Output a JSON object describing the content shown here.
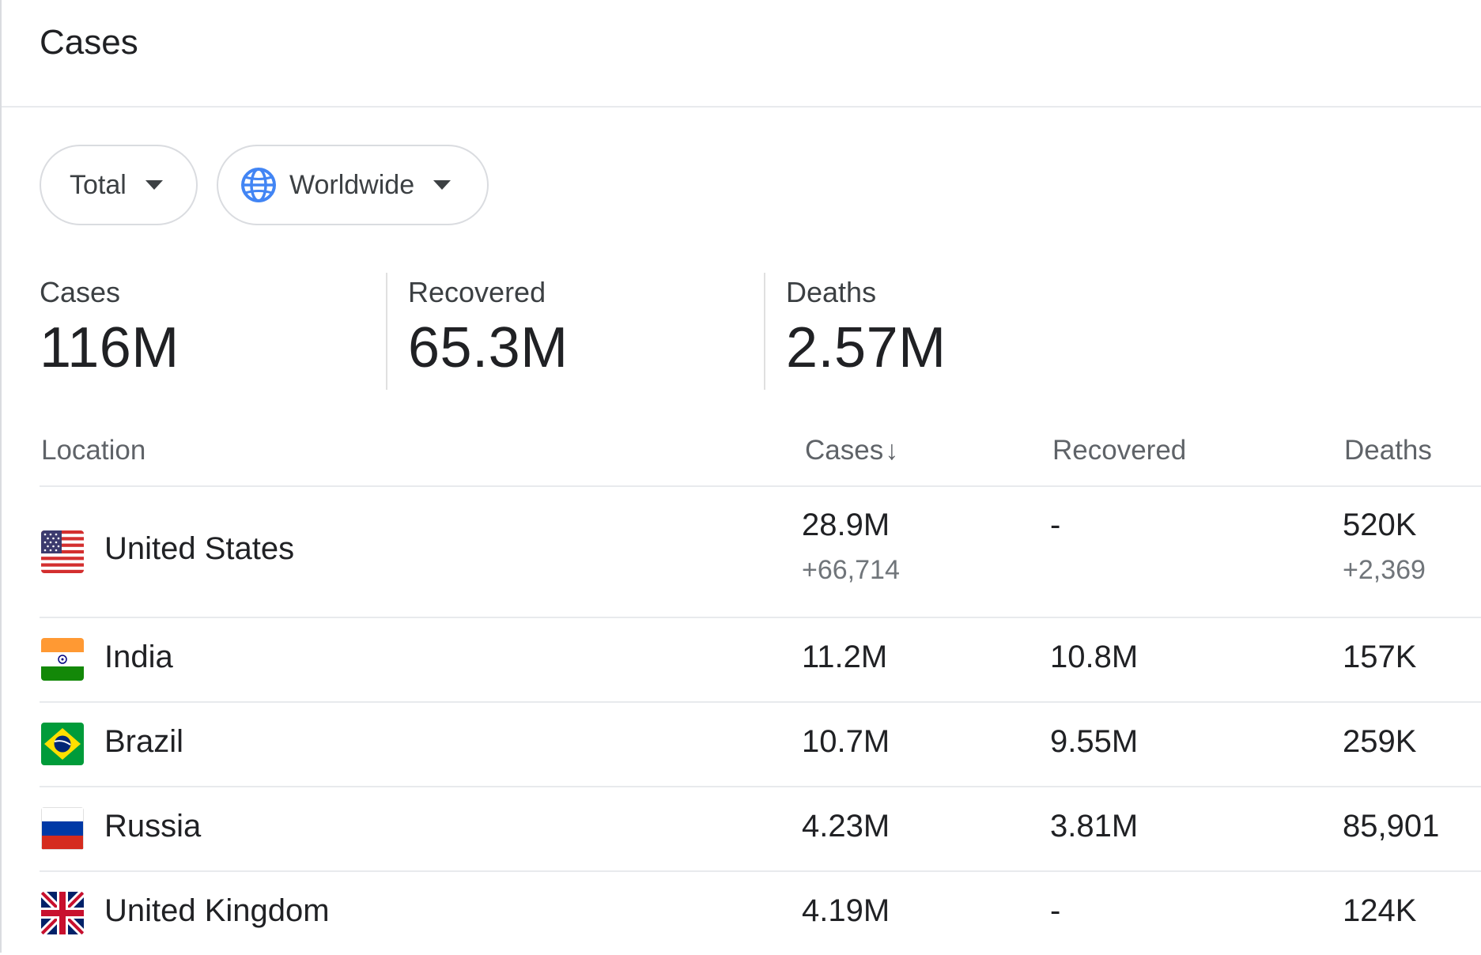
{
  "header": {
    "title": "Cases"
  },
  "filters": {
    "period": {
      "label": "Total"
    },
    "region": {
      "label": "Worldwide",
      "icon": "globe-icon"
    }
  },
  "stats": [
    {
      "label": "Cases",
      "value": "116M"
    },
    {
      "label": "Recovered",
      "value": "65.3M"
    },
    {
      "label": "Deaths",
      "value": "2.57M"
    }
  ],
  "table": {
    "columns": {
      "location": "Location",
      "cases": "Cases",
      "cases_sort_icon": "↓",
      "recovered": "Recovered",
      "deaths": "Deaths"
    },
    "rows": [
      {
        "country": "United States",
        "flag": "us-flag-icon",
        "cases": "28.9M",
        "cases_new": "+66,714",
        "recovered": "-",
        "deaths": "520K",
        "deaths_new": "+2,369"
      },
      {
        "country": "India",
        "flag": "india-flag-icon",
        "cases": "11.2M",
        "recovered": "10.8M",
        "deaths": "157K"
      },
      {
        "country": "Brazil",
        "flag": "brazil-flag-icon",
        "cases": "10.7M",
        "recovered": "9.55M",
        "deaths": "259K"
      },
      {
        "country": "Russia",
        "flag": "russia-flag-icon",
        "cases": "4.23M",
        "recovered": "3.81M",
        "deaths": "85,901"
      },
      {
        "country": "United Kingdom",
        "flag": "uk-flag-icon",
        "cases": "4.19M",
        "recovered": "-",
        "deaths": "124K"
      }
    ]
  },
  "colors": {
    "globe": "#4285f4",
    "divider": "#e8eaed",
    "muted": "#70757a"
  }
}
